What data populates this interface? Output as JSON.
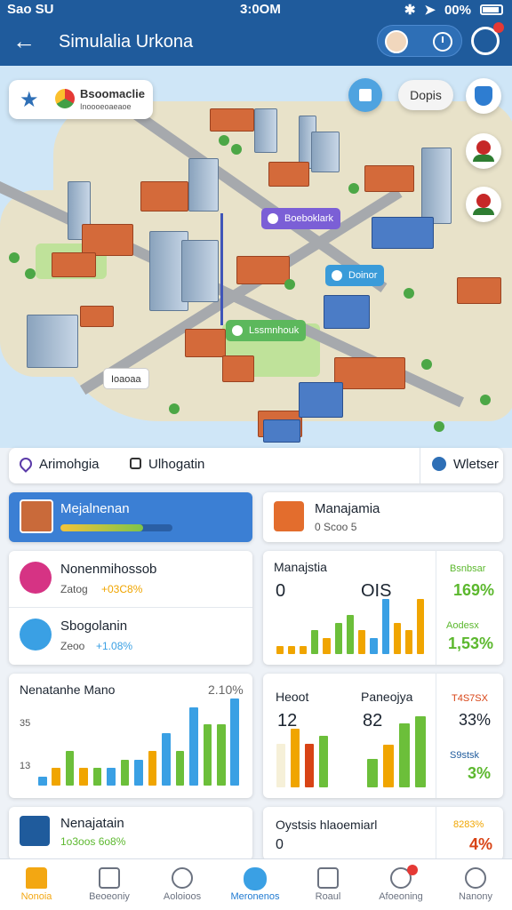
{
  "status_bar": {
    "carrier": "Sao SU",
    "time": "3:0OM",
    "battery": "00%"
  },
  "header": {
    "title": "Simulalia Urkona"
  },
  "map": {
    "brand_title": "Bsoomaclie",
    "brand_subtitle": "Inoooeoaeaoe",
    "pill_label": "Dopis",
    "labels": {
      "purple": "Boeboklark",
      "blue": "Doinor",
      "green": "Lssmnhouk",
      "white": "Ioaoaa"
    }
  },
  "filters": {
    "item1": "Arimohgia",
    "item2": "Ulhogatin",
    "item3": "Wletser"
  },
  "cards": {
    "left_active": {
      "title": "Mejalnenan",
      "progress": 0.74
    },
    "right_top": {
      "title": "Manajamia",
      "sub": "0 Scoo 5"
    },
    "list_a": {
      "title": "Nonenmihossob",
      "sub_prefix": "Zatog",
      "sub_value": "+03C8%"
    },
    "list_b": {
      "title": "Sbogolanin",
      "sub_prefix": "Zeoo",
      "sub_value": "+1.08%"
    },
    "stats": {
      "title": "Manajstia",
      "left_value": "0",
      "right_value": "OIS",
      "side_top_label": "Bsnbsar",
      "side_top_pct": "169%",
      "side_bottom_label": "Aodesx",
      "side_bottom_pct": "1,53%"
    },
    "trend": {
      "title": "Nenatanhe Mano",
      "value": "2.10%",
      "y_top": "35",
      "y_bottom": "13"
    },
    "compare": {
      "left_title": "Heoot",
      "left_value": "12",
      "right_title": "Paneojya",
      "right_value": "82",
      "side_top_label": "T4S7SX",
      "side_top_pct": "33%",
      "side_bottom_label": "S9stsk",
      "side_bottom_pct": "3%"
    },
    "bottom_left": {
      "title": "Nenajatain",
      "sub": "1o3oos 6o8%"
    },
    "bottom_right": {
      "title": "Oystsis hlaoemiarl",
      "value": "0",
      "side_label": "8283%",
      "side_pct": "4%"
    }
  },
  "nav": {
    "items": [
      "Nonoia",
      "Beoeoniy",
      "Aoloioos",
      "Meronenos",
      "Roaul",
      "Afoeoning",
      "Nanony"
    ]
  },
  "chart_data": [
    {
      "type": "bar",
      "title": "Manajstia",
      "values": [
        1,
        1,
        1,
        3,
        2,
        4,
        5,
        3,
        2,
        7,
        4,
        3,
        7
      ],
      "colors": [
        "#f0a500",
        "#f0a500",
        "#f0a500",
        "#6cbf3a",
        "#f0a500",
        "#6cbf3a",
        "#6cbf3a",
        "#f0a500",
        "#3aa0e4",
        "#3aa0e4",
        "#f0a500",
        "#f0a500",
        "#f0a500"
      ]
    },
    {
      "type": "bar",
      "title": "Nenatanhe Mano",
      "values": [
        1,
        2,
        4,
        2,
        2,
        2,
        3,
        3,
        4,
        6,
        4,
        9,
        7,
        7,
        10
      ],
      "colors": [
        "#3aa0e4",
        "#f0a500",
        "#6cbf3a",
        "#f0a500",
        "#6cbf3a",
        "#3aa0e4",
        "#6cbf3a",
        "#3aa0e4",
        "#f0a500",
        "#3aa0e4",
        "#6cbf3a",
        "#3aa0e4",
        "#6cbf3a",
        "#6cbf3a",
        "#3aa0e4"
      ]
    },
    {
      "type": "bar",
      "title": "Heoot",
      "values": [
        6,
        8,
        6,
        7
      ],
      "colors": [
        "#f6f0d8",
        "#f0a500",
        "#d84315",
        "#6cbf3a"
      ]
    },
    {
      "type": "bar",
      "title": "Paneojya",
      "values": [
        4,
        6,
        9,
        10
      ],
      "colors": [
        "#6cbf3a",
        "#f0a500",
        "#6cbf3a",
        "#6cbf3a"
      ]
    }
  ],
  "colors": {
    "primary": "#1f5b9c",
    "accent_blue": "#3aa0e4",
    "green": "#5cb82e",
    "orange": "#f0a500",
    "red": "#d84315"
  }
}
